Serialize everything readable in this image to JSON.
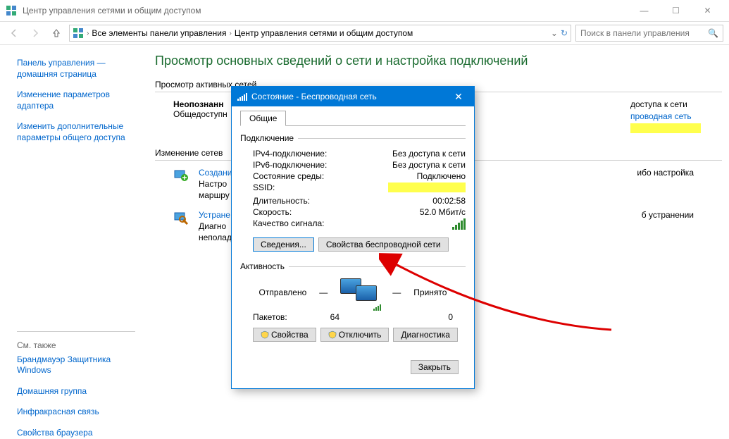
{
  "window": {
    "title": "Центр управления сетями и общим доступом",
    "controls": {
      "min": "—",
      "max": "☐",
      "close": "✕"
    }
  },
  "toolbar": {
    "breadcrumb": {
      "seg1": "Все элементы панели управления",
      "seg2": "Центр управления сетями и общим доступом"
    },
    "search": {
      "placeholder": "Поиск в панели управления"
    }
  },
  "sidebar": {
    "links": [
      "Панель управления — домашняя страница",
      "Изменение параметров адаптера",
      "Изменить дополнительные параметры общего доступа"
    ],
    "seealso_label": "См. также",
    "seealso": [
      "Брандмауэр Защитника Windows",
      "Домашняя группа",
      "Инфракрасная связь",
      "Свойства браузера"
    ]
  },
  "main": {
    "heading": "Просмотр основных сведений о сети и настройка подключений",
    "section_active": "Просмотр активных сетей",
    "net_name": "Неопознанн",
    "net_type": "Общедоступн",
    "net_access_label_partial": "доступа к сети",
    "net_conn_partial": "проводная сеть",
    "section_change": "Изменение сетев",
    "action_create": "Создани",
    "action_create_desc1": "Настро",
    "action_create_desc2": "маршру",
    "action_create_tail": "ибо настройка",
    "action_trouble": "Устране",
    "action_trouble_desc1": "Диагно",
    "action_trouble_desc2": "неполад",
    "action_trouble_tail": "б устранении"
  },
  "dialog": {
    "title": "Состояние - Беспроводная сеть",
    "tab_general": "Общие",
    "grp_conn": "Подключение",
    "rows": {
      "ipv4_k": "IPv4-подключение:",
      "ipv4_v": "Без доступа к сети",
      "ipv6_k": "IPv6-подключение:",
      "ipv6_v": "Без доступа к сети",
      "media_k": "Состояние среды:",
      "media_v": "Подключено",
      "ssid_k": "SSID:",
      "dur_k": "Длительность:",
      "dur_v": "00:02:58",
      "speed_k": "Скорость:",
      "speed_v": "52.0 Мбит/с",
      "signal_k": "Качество сигнала:"
    },
    "btn_details": "Сведения...",
    "btn_wprops": "Свойства беспроводной сети",
    "grp_activity": "Активность",
    "sent": "Отправлено",
    "recv": "Принято",
    "pkts_label": "Пакетов:",
    "pkts_sent": "64",
    "pkts_recv": "0",
    "btn_props": "Свойства",
    "btn_disable": "Отключить",
    "btn_diag": "Диагностика",
    "btn_close": "Закрыть"
  }
}
